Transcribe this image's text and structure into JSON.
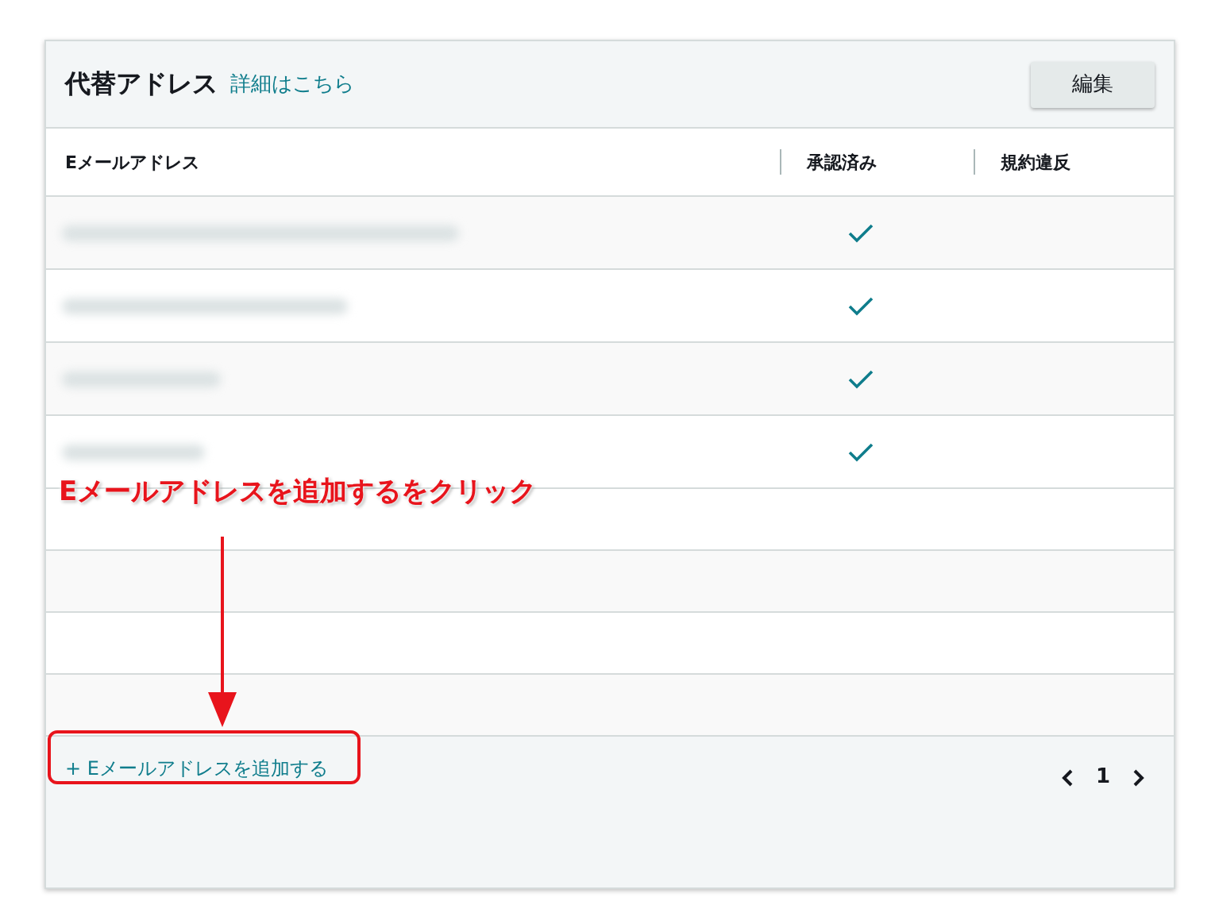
{
  "header": {
    "title": "代替アドレス",
    "link": "詳細はこちら",
    "edit_button": "編集"
  },
  "table": {
    "columns": [
      "Eメールアドレス",
      "承認済み",
      "規約違反"
    ],
    "rows": [
      {
        "approved": true
      },
      {
        "approved": true
      },
      {
        "approved": true
      },
      {
        "approved": true
      }
    ]
  },
  "footer": {
    "add_link": "+ Eメールアドレスを追加する",
    "pagination": {
      "page": "1"
    }
  },
  "annotation": {
    "text": "Eメールアドレスを追加するをクリック"
  }
}
